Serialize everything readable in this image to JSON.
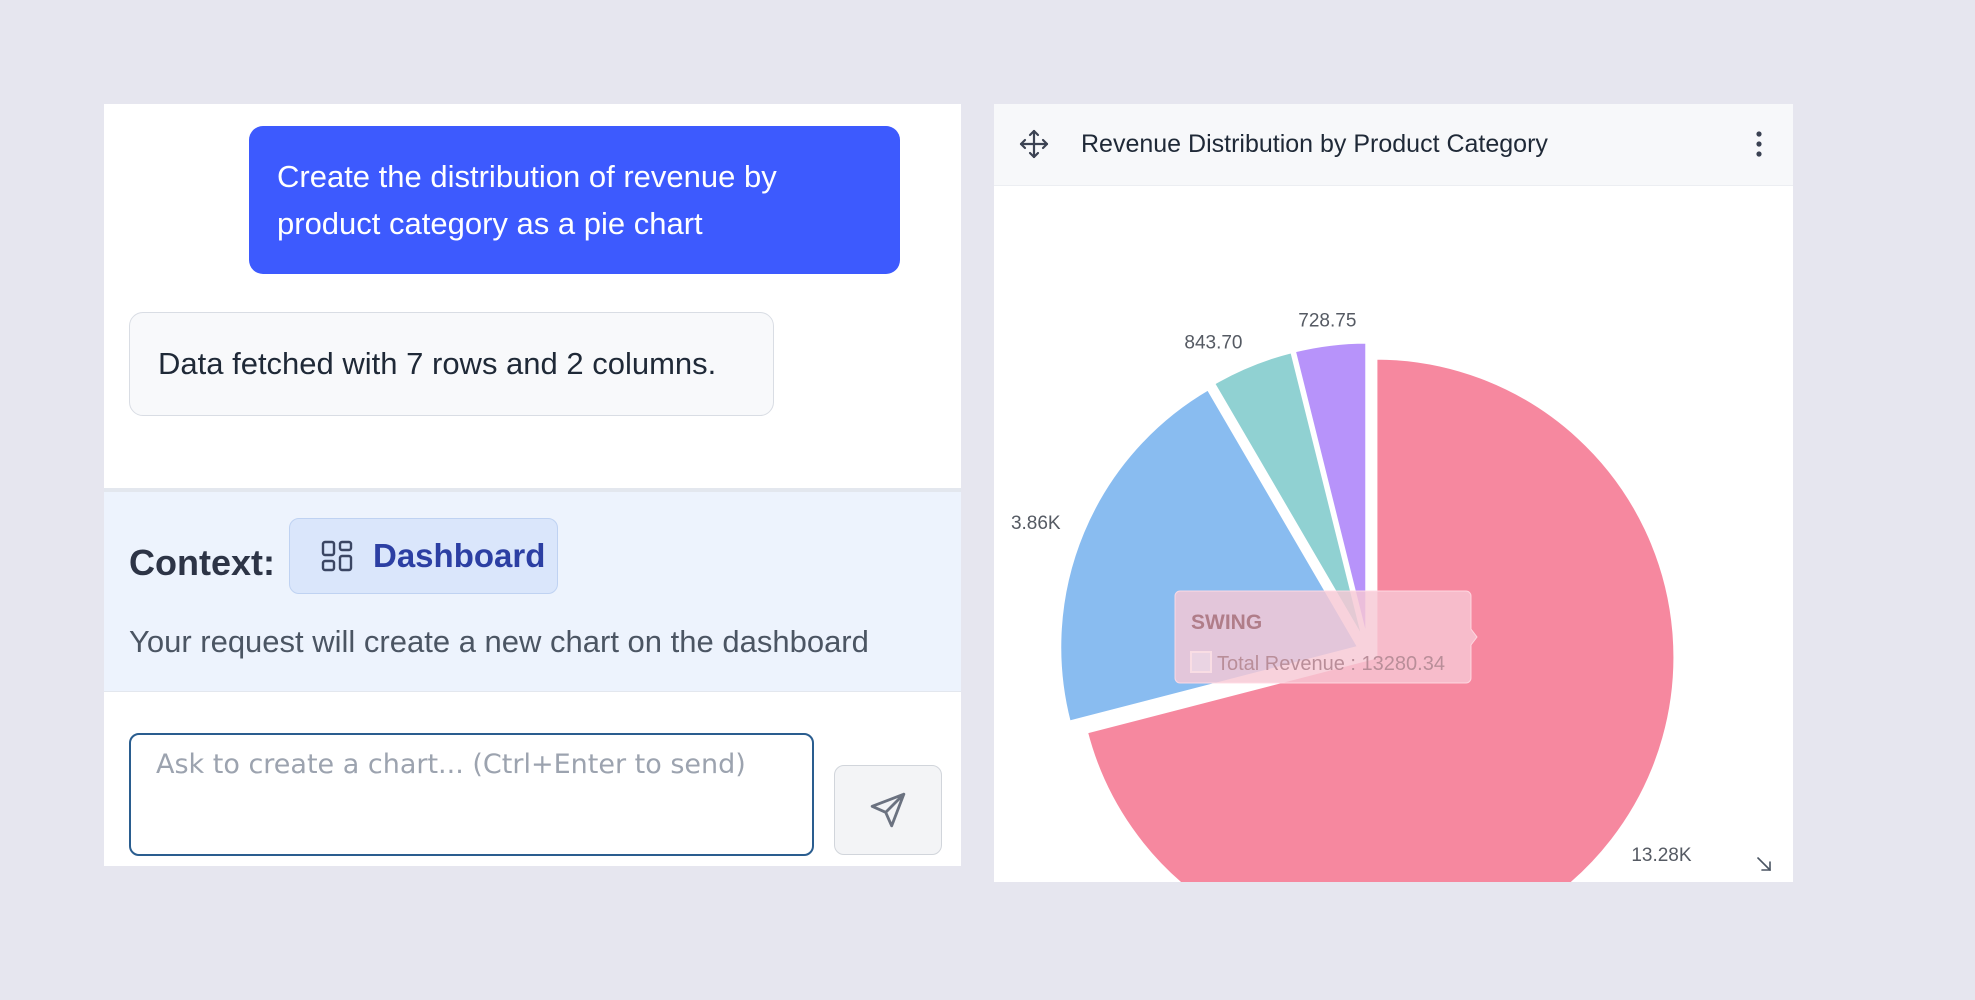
{
  "chat": {
    "user_message": "Create the distribution of revenue by product category as a pie chart",
    "bot_message": "Data fetched with 7 rows and 2 columns.",
    "context": {
      "label": "Context:",
      "chip_label": "Dashboard",
      "chip_icon": "dashboard-icon",
      "description": "Your request will create a new chart on the dashboard"
    },
    "input": {
      "value": "",
      "placeholder": "Ask to create a chart... (Ctrl+Enter to send)"
    },
    "send_icon": "send-icon"
  },
  "chart_card": {
    "title": "Revenue Distribution by Product Category",
    "icons": {
      "move": "move-icon",
      "menu": "kebab-menu-icon",
      "resize": "resize-icon"
    }
  },
  "chart_data": {
    "type": "pie",
    "title": "Revenue Distribution by Product Category",
    "slices": [
      {
        "label": "SWING",
        "value": 13280.34,
        "display": "13.28K",
        "color": "#f6889f"
      },
      {
        "label": "",
        "value": 3860,
        "display": "3.86K",
        "color": "#89bcf0"
      },
      {
        "label": "",
        "value": 843.7,
        "display": "843.70",
        "color": "#90d1d2"
      },
      {
        "label": "",
        "value": 728.75,
        "display": "728.75",
        "color": "#b793fa"
      }
    ],
    "tooltip": {
      "category": "SWING",
      "series": "Total Revenue",
      "value": "13280.34",
      "text": "Total Revenue : 13280.34"
    },
    "legend": "none"
  }
}
